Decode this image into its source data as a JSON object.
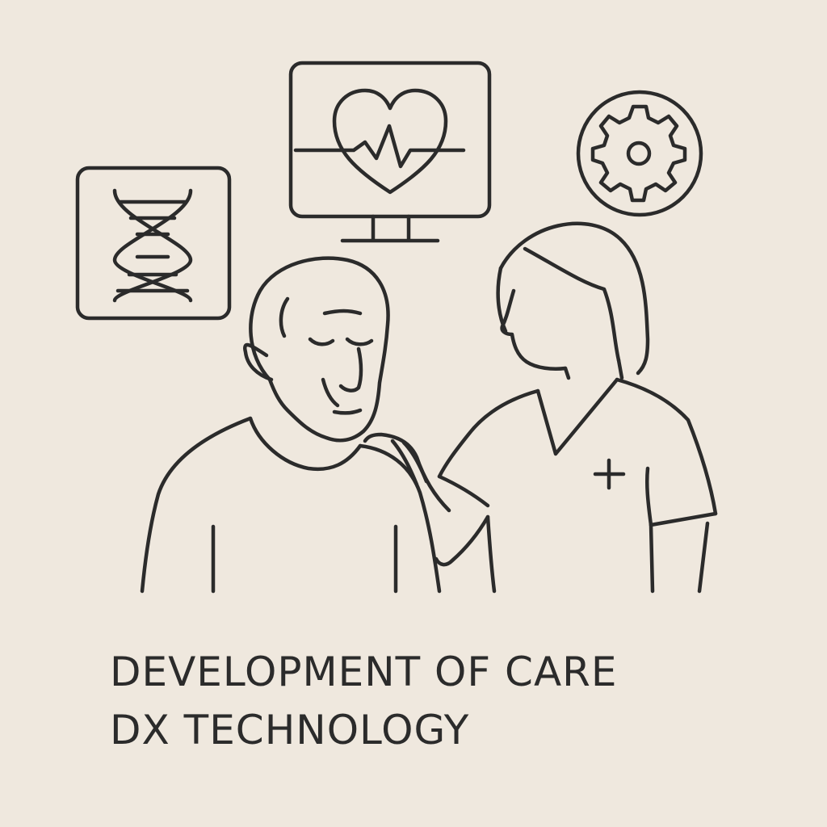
{
  "illustration": {
    "icons": [
      "dna-icon",
      "heart-monitor-icon",
      "gear-icon",
      "medical-cross-icon"
    ],
    "figures": [
      "elderly-man",
      "nurse"
    ],
    "colors": {
      "background": "#efe8de",
      "line": "#2b2b2b"
    }
  },
  "caption": {
    "line1": "DEVELOPMENT OF CARE",
    "line2": "DX TECHNOLOGY"
  }
}
